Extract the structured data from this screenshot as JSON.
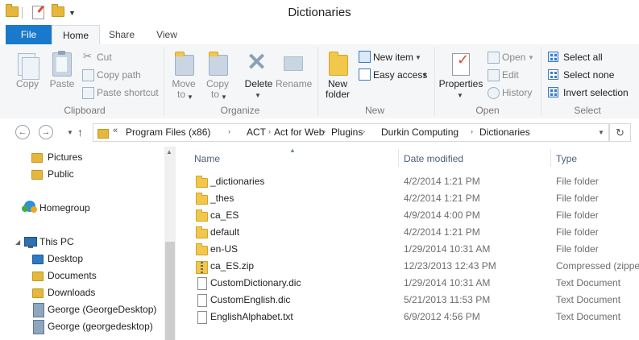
{
  "window": {
    "title": "Dictionaries"
  },
  "tabs": {
    "file": "File",
    "home": "Home",
    "share": "Share",
    "view": "View"
  },
  "ribbon": {
    "clipboard": {
      "label": "Clipboard",
      "copy": "Copy",
      "paste": "Paste",
      "cut": "Cut",
      "copy_path": "Copy path",
      "paste_shortcut": "Paste shortcut"
    },
    "organize": {
      "label": "Organize",
      "move_to_1": "Move",
      "move_to_2": "to",
      "copy_to_1": "Copy",
      "copy_to_2": "to",
      "delete": "Delete",
      "rename": "Rename"
    },
    "new": {
      "label": "New",
      "new_folder_1": "New",
      "new_folder_2": "folder",
      "new_item": "New item",
      "easy_access": "Easy access"
    },
    "open": {
      "label": "Open",
      "properties": "Properties",
      "open": "Open",
      "edit": "Edit",
      "history": "History"
    },
    "select": {
      "label": "Select",
      "select_all": "Select all",
      "select_none": "Select none",
      "invert_selection": "Invert selection"
    }
  },
  "address": {
    "overflow": "«",
    "crumbs": [
      "Program Files (x86)",
      "ACT",
      "Act for Web",
      "Plugins",
      "Durkin Computing",
      "Dictionaries"
    ]
  },
  "navpane": {
    "items": [
      "Pictures",
      "Public",
      "Homegroup",
      "This PC",
      "Desktop",
      "Documents",
      "Downloads",
      "George (GeorgeDesktop)",
      "George (georgedesktop)"
    ]
  },
  "columns": {
    "name": "Name",
    "date": "Date modified",
    "type": "Type"
  },
  "files": [
    {
      "name": "_dictionaries",
      "date": "4/2/2014 1:21 PM",
      "type": "File folder",
      "icon": "folder-icon"
    },
    {
      "name": "_thes",
      "date": "4/2/2014 1:21 PM",
      "type": "File folder",
      "icon": "folder-icon"
    },
    {
      "name": "ca_ES",
      "date": "4/9/2014 4:00 PM",
      "type": "File folder",
      "icon": "folder-icon"
    },
    {
      "name": "default",
      "date": "4/2/2014 1:21 PM",
      "type": "File folder",
      "icon": "folder-icon"
    },
    {
      "name": "en-US",
      "date": "1/29/2014 10:31 AM",
      "type": "File folder",
      "icon": "folder-icon"
    },
    {
      "name": "ca_ES.zip",
      "date": "12/23/2013 12:43 PM",
      "type": "Compressed (zipped",
      "icon": "zip-icon"
    },
    {
      "name": "CustomDictionary.dic",
      "date": "1/29/2014 10:31 AM",
      "type": "Text Document",
      "icon": "document-icon"
    },
    {
      "name": "CustomEnglish.dic",
      "date": "5/21/2013 11:53 PM",
      "type": "Text Document",
      "icon": "document-icon"
    },
    {
      "name": "EnglishAlphabet.txt",
      "date": "6/9/2012 4:56 PM",
      "type": "Text Document",
      "icon": "document-icon"
    }
  ]
}
